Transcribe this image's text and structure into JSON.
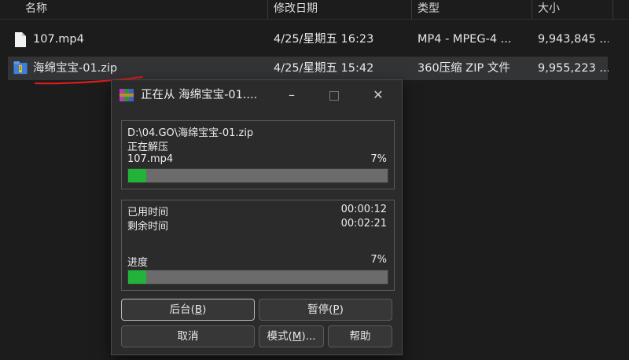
{
  "columns": {
    "name": "名称",
    "modified": "修改日期",
    "type": "类型",
    "size": "大小"
  },
  "files": [
    {
      "icon": "document-file-icon",
      "name": "107.mp4",
      "modified": "4/25/星期五 16:23",
      "type": "MP4 - MPEG-4 ...",
      "size": "9,943,845 ..."
    },
    {
      "icon": "winrar-archive-icon",
      "name": "海绵宝宝-01.zip",
      "modified": "4/25/星期五 15:42",
      "type": "360压缩 ZIP 文件",
      "size": "9,955,223 ..."
    }
  ],
  "dialog": {
    "title": "正在从 海绵宝宝-01....",
    "archive_path": "D:\\04.GO\\海绵宝宝-01.zip",
    "status": "正在解压",
    "current_file": "107.mp4",
    "file_percent_text": "7%",
    "file_progress": 0.07,
    "elapsed_label": "已用时间",
    "elapsed_value": "00:00:12",
    "remaining_label": "剩余时间",
    "remaining_value": "00:02:21",
    "progress_label": "进度",
    "total_percent_text": "7%",
    "total_progress": 0.07,
    "buttons": {
      "background": {
        "text": "后台(",
        "key": "B",
        "end": ")"
      },
      "pause": {
        "text": "暂停(",
        "key": "P",
        "end": ")"
      },
      "cancel": {
        "text": "取消"
      },
      "mode": {
        "text": "模式(",
        "key": "M",
        "end": ")..."
      },
      "help": {
        "text": "帮助"
      }
    }
  },
  "colors": {
    "progress_fill": "#22b43a",
    "annotation_underline": "#d81e1e"
  }
}
